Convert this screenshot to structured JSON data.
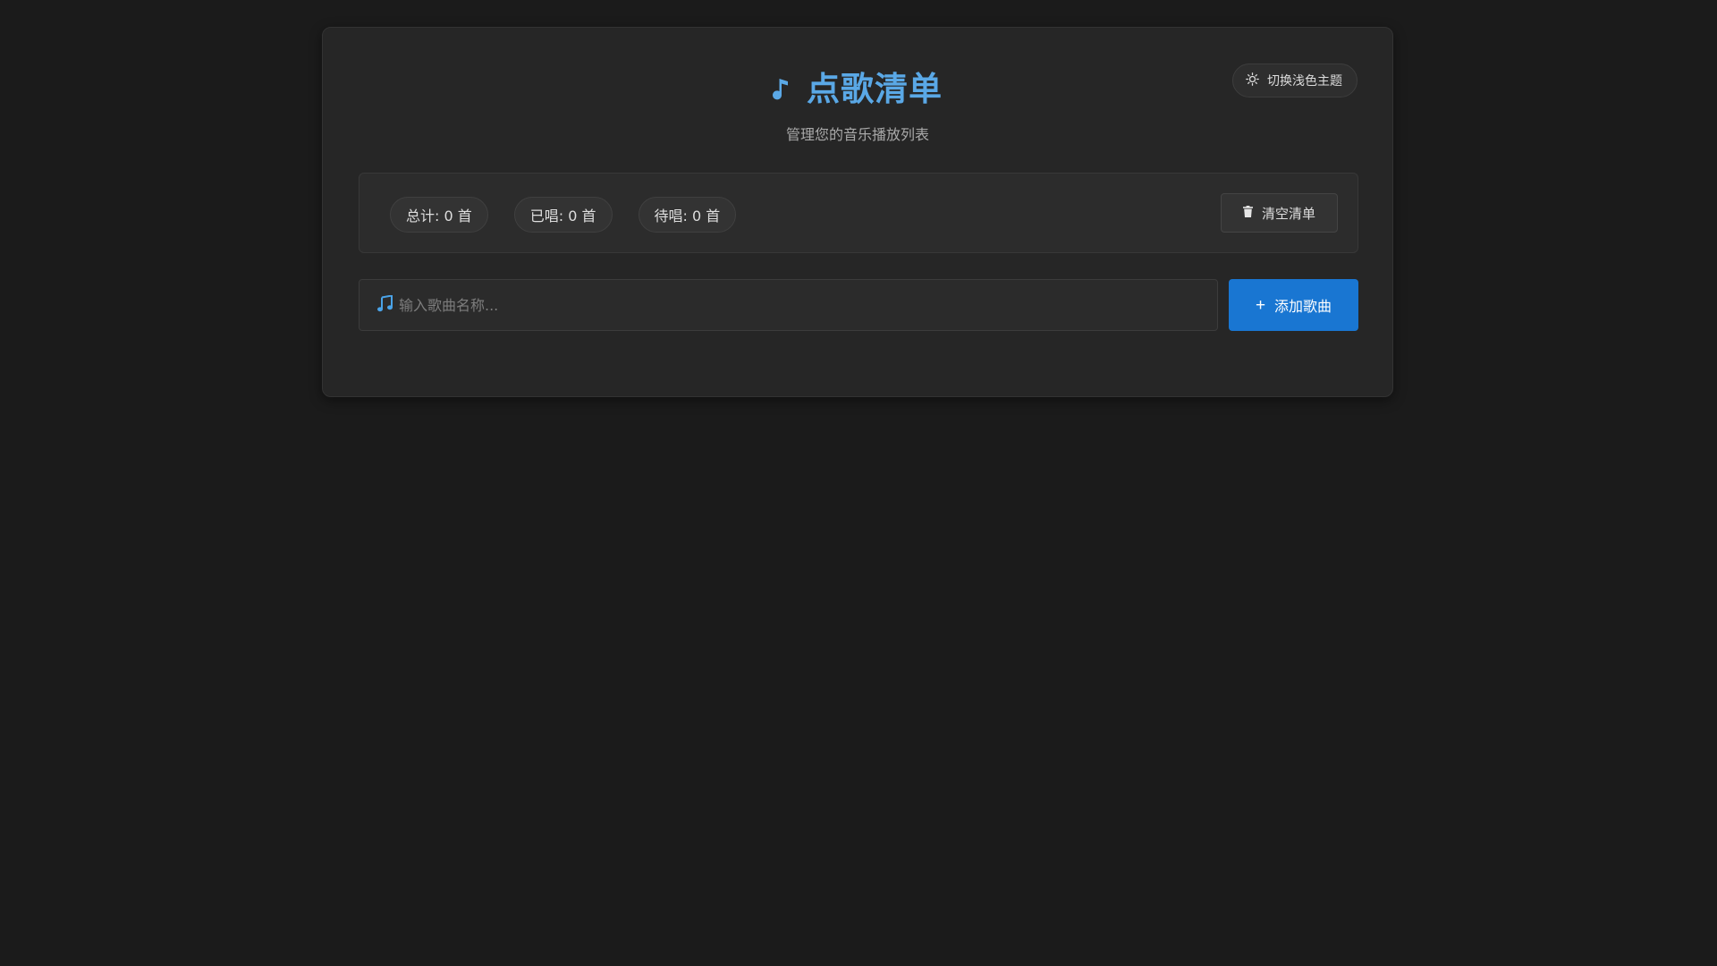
{
  "header": {
    "title": "点歌清单",
    "subtitle": "管理您的音乐播放列表",
    "title_icon": "music-note-icon"
  },
  "theme_toggle": {
    "label": "切换浅色主题",
    "icon": "sun-icon"
  },
  "stats": {
    "total": "总计: 0 首",
    "sung": "已唱: 0 首",
    "pending": "待唱: 0 首"
  },
  "clear_button": {
    "label": "清空清单",
    "icon": "trash-icon"
  },
  "song_input": {
    "value": "",
    "placeholder": "输入歌曲名称...",
    "icon": "music-notes-icon"
  },
  "add_button": {
    "label": "添加歌曲",
    "icon": "plus-icon"
  },
  "colors": {
    "accent": "#5aa8e6",
    "primary_button": "#1976d2",
    "background": "#1b1b1b",
    "card": "#262626"
  }
}
